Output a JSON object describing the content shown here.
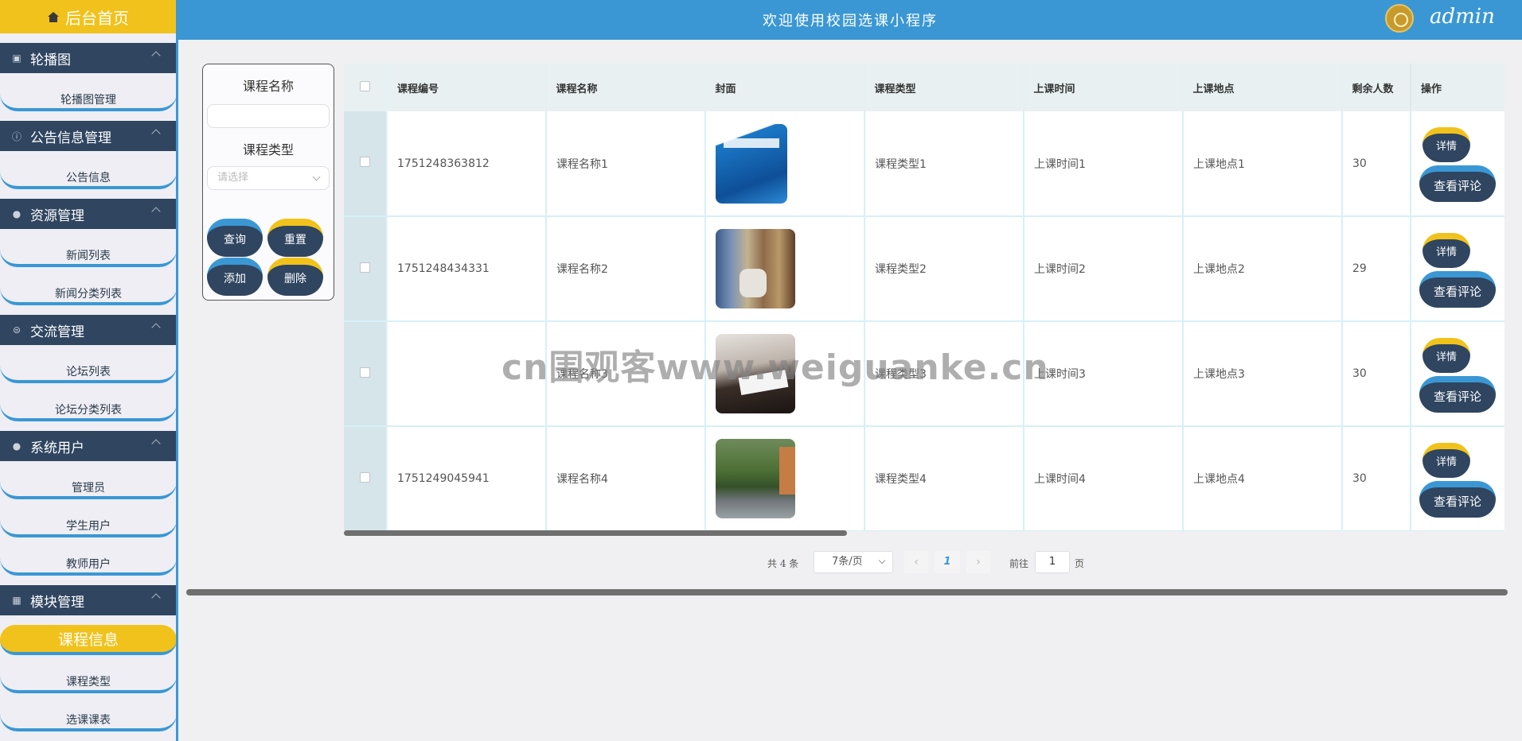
{
  "header": {
    "title": "欢迎使用校园选课小程序",
    "user": "admin"
  },
  "sidebar": {
    "home": "后台首页",
    "groups": [
      {
        "title": "轮播图",
        "items": [
          "轮播图管理"
        ]
      },
      {
        "title": "公告信息管理",
        "items": [
          "公告信息"
        ]
      },
      {
        "title": "资源管理",
        "items": [
          "新闻列表",
          "新闻分类列表"
        ]
      },
      {
        "title": "交流管理",
        "items": [
          "论坛列表",
          "论坛分类列表"
        ]
      },
      {
        "title": "系统用户",
        "items": [
          "管理员",
          "学生用户",
          "教师用户"
        ]
      },
      {
        "title": "模块管理",
        "items": [
          "课程信息",
          "课程类型",
          "选课课表"
        ]
      }
    ],
    "active_item": "课程信息"
  },
  "search": {
    "course_name_label": "课程名称",
    "course_name_value": "",
    "course_type_label": "课程类型",
    "course_type_placeholder": "请选择",
    "query_btn": "查询",
    "reset_btn": "重置",
    "add_btn": "添加",
    "delete_btn": "删除"
  },
  "table": {
    "columns": [
      "课程编号",
      "课程名称",
      "封面",
      "课程类型",
      "上课时间",
      "上课地点",
      "剩余人数",
      "操作"
    ],
    "rows": [
      {
        "id": "1751248363812",
        "name": "课程名称1",
        "type": "课程类型1",
        "time": "上课时间1",
        "place": "上课地点1",
        "remaining": "30"
      },
      {
        "id": "1751248434331",
        "name": "课程名称2",
        "type": "课程类型2",
        "time": "上课时间2",
        "place": "上课地点2",
        "remaining": "29"
      },
      {
        "id": "",
        "name": "课程名称3",
        "type": "课程类型3",
        "time": "上课时间3",
        "place": "上课地点3",
        "remaining": "30"
      },
      {
        "id": "1751249045941",
        "name": "课程名称4",
        "type": "课程类型4",
        "time": "上课时间4",
        "place": "上课地点4",
        "remaining": "30"
      }
    ],
    "detail_btn": "详情",
    "review_btn": "查看评论"
  },
  "pagination": {
    "total_text": "共 4 条",
    "page_size": "7条/页",
    "prev": "‹",
    "current": "1",
    "next": "›",
    "goto_label": "前往",
    "goto_value": "1",
    "page_unit": "页"
  },
  "watermark": "cn围观客www.weiguanke.cn",
  "colors": {
    "accent": "#3a97d4",
    "highlight": "#f1c21b",
    "dark": "#2f4560"
  }
}
